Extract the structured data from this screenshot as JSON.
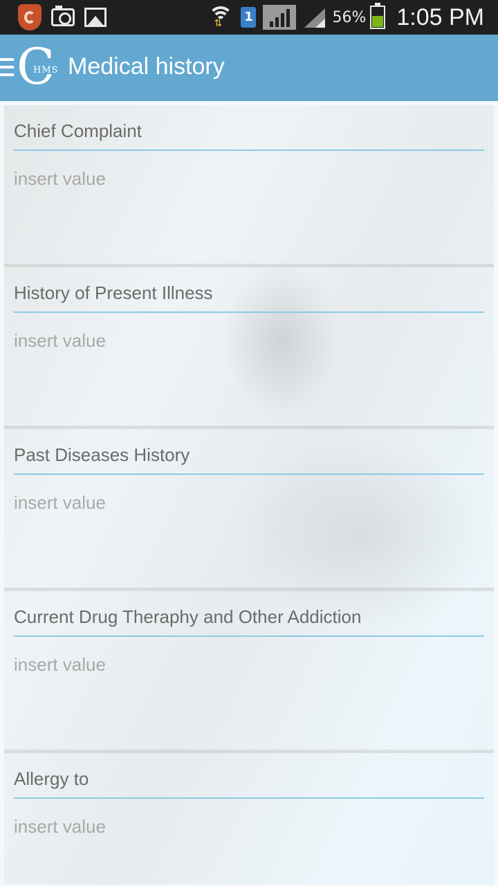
{
  "status_bar": {
    "battery_percent": "56%",
    "time": "1:05 PM",
    "sim_label": "1",
    "icons": [
      "shield-app-icon",
      "camera-icon",
      "gallery-icon",
      "wifi-icon",
      "sim-icon",
      "signal-icon",
      "signal-secondary-icon",
      "battery-icon"
    ],
    "battery_color": "#7cb518"
  },
  "action_bar": {
    "title": "Medical history",
    "logo_letter": "C",
    "logo_text": "HMS",
    "background_color": "#62a8d1"
  },
  "sections": [
    {
      "label": "Chief Complaint",
      "placeholder": "insert value"
    },
    {
      "label": "History of Present Illness",
      "placeholder": "insert value"
    },
    {
      "label": "Past Diseases History",
      "placeholder": "insert value"
    },
    {
      "label": "Current Drug Theraphy and Other Addiction",
      "placeholder": "insert value"
    },
    {
      "label": "Allergy to",
      "placeholder": "insert value"
    }
  ]
}
